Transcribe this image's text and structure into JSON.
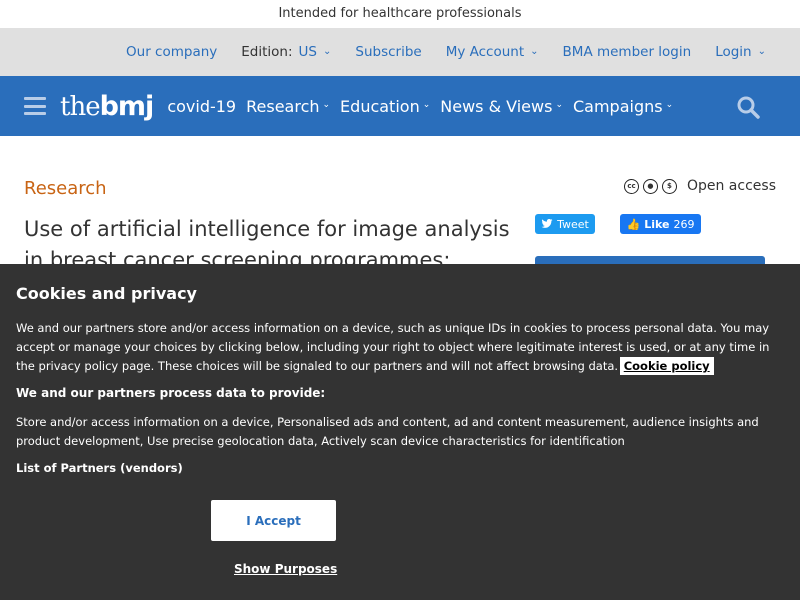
{
  "hcp_notice": "Intended for healthcare professionals",
  "utility_nav": {
    "our_company": "Our company",
    "edition_label": "Edition:",
    "edition_value": "US",
    "subscribe": "Subscribe",
    "my_account": "My Account",
    "bma_login": "BMA member login",
    "login": "Login"
  },
  "main_nav": {
    "logo_the": "the",
    "logo_bmj": "bmj",
    "items": [
      {
        "label": "covid-19",
        "dropdown": false
      },
      {
        "label": "Research",
        "dropdown": true
      },
      {
        "label": "Education",
        "dropdown": true
      },
      {
        "label": "News & Views",
        "dropdown": true
      },
      {
        "label": "Campaigns",
        "dropdown": true
      }
    ]
  },
  "article": {
    "section": "Research",
    "license_icons": [
      "cc",
      "by",
      "nc"
    ],
    "open_access": "Open access",
    "title": "Use of artificial intelligence for image analysis in breast cancer screening programmes: systematic"
  },
  "social": {
    "tweet": "Tweet",
    "like": "Like",
    "like_count": "269"
  },
  "cookie_banner": {
    "title": "Cookies and privacy",
    "body": "We and our partners store and/or access information on a device, such as unique IDs in cookies to process personal data. You may accept or manage your choices by clicking below, including your right to object where legitimate interest is used, or at any time in the privacy policy page. These choices will be signaled to our partners and will not affect browsing data.",
    "cookie_policy_link": "Cookie policy",
    "subheading": "We and our partners process data to provide:",
    "purposes": "Store and/or access information on a device, Personalised ads and content, ad and content measurement, audience insights and product development, Use precise geolocation data, Actively scan device characteristics for identification",
    "vendors_link": "List of Partners (vendors)",
    "accept": "I Accept",
    "show_purposes": "Show Purposes"
  },
  "colors": {
    "brand_blue": "#2a6ebb",
    "section_orange": "#c86414",
    "overlay": "#333333"
  }
}
